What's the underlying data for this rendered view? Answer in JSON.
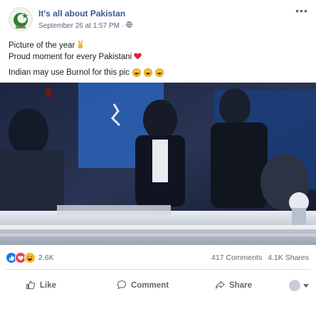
{
  "page": {
    "name": "It's all about Pakistan",
    "date": "September 26 at 1:57 PM",
    "separator": "·"
  },
  "caption": {
    "line1": "Picture of the year",
    "line2": "Proud moment for every Pakistani",
    "line3": "Indian may use Burnol for this pic"
  },
  "icons": {
    "avatar": "page-avatar-icon",
    "globe": "globe-icon",
    "more": "more-options-icon",
    "victory": "victory-hand-emoji",
    "heart": "red-heart-emoji",
    "laugh": "laughing-emoji",
    "like": "thumbs-up-icon",
    "comment": "comment-icon",
    "share": "share-icon"
  },
  "reactions": {
    "count": "2.6K",
    "types": [
      "like",
      "love",
      "haha"
    ],
    "comments": "417 Comments",
    "shares": "4.1K Shares"
  },
  "actions": {
    "like": "Like",
    "comment": "Comment",
    "share": "Share"
  },
  "colors": {
    "link": "#385898",
    "muted": "#606770",
    "like": "#1877f2",
    "love": "#f33e58",
    "haha": "#f7b928"
  }
}
